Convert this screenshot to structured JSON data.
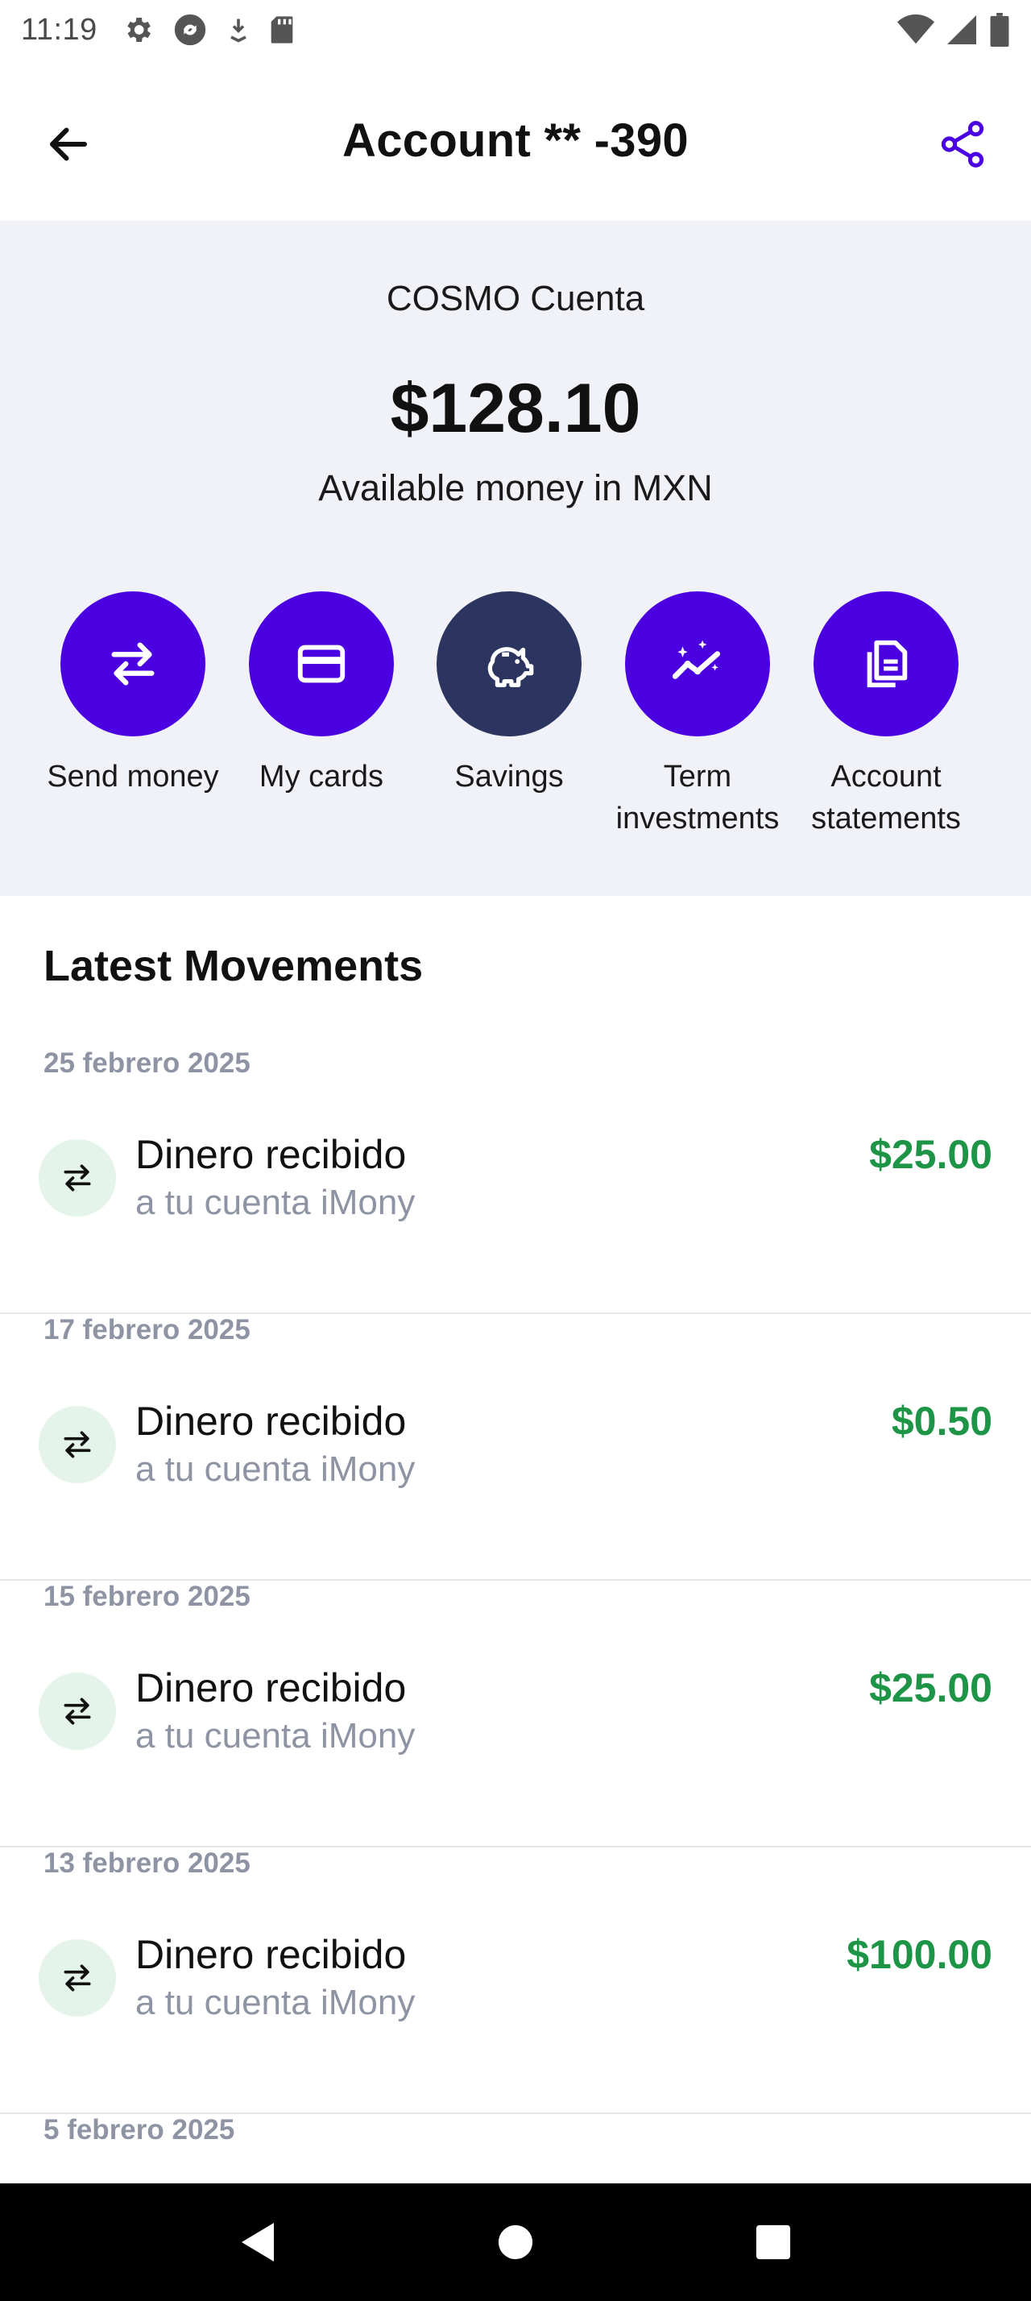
{
  "status_bar": {
    "time": "11:19",
    "left_icons": [
      "gear-icon",
      "sync-icon",
      "download-icon",
      "sd-card-icon"
    ],
    "right_icons": [
      "wifi-icon",
      "cell-signal-icon",
      "battery-icon"
    ]
  },
  "app_bar": {
    "title": "Account ** -390",
    "back_icon": "arrow-left-icon",
    "share_icon": "share-icon",
    "accent_color": "#4a00e0"
  },
  "account": {
    "name": "COSMO Cuenta",
    "balance": "$128.10",
    "balance_caption": "Available money in MXN"
  },
  "actions": [
    {
      "label": "Send money",
      "icon": "transfer-arrows-icon",
      "color": "#4a00e0"
    },
    {
      "label": "My cards",
      "icon": "card-icon",
      "color": "#4a00e0"
    },
    {
      "label": "Savings",
      "icon": "piggy-bank-icon",
      "color": "#2c3560"
    },
    {
      "label": "Term\ninvestments",
      "icon": "chart-sparkle-icon",
      "color": "#4a00e0"
    },
    {
      "label": "Account\nstatements",
      "icon": "documents-icon",
      "color": "#4a00e0"
    }
  ],
  "movements": {
    "title": "Latest Movements",
    "groups": [
      {
        "date": "25 febrero 2025",
        "title": "Dinero recibido",
        "subtitle": "a tu cuenta iMony",
        "amount": "$25.00"
      },
      {
        "date": "17 febrero 2025",
        "title": "Dinero recibido",
        "subtitle": "a tu cuenta iMony",
        "amount": "$0.50"
      },
      {
        "date": "15 febrero 2025",
        "title": "Dinero recibido",
        "subtitle": "a tu cuenta iMony",
        "amount": "$25.00"
      },
      {
        "date": "13 febrero 2025",
        "title": "Dinero recibido",
        "subtitle": "a tu cuenta iMony",
        "amount": "$100.00"
      },
      {
        "date": "5 febrero 2025"
      }
    ],
    "amount_color": "#1e9447"
  },
  "nav_bar": {
    "buttons": [
      "back-triangle-icon",
      "home-circle-icon",
      "recents-square-icon"
    ]
  }
}
